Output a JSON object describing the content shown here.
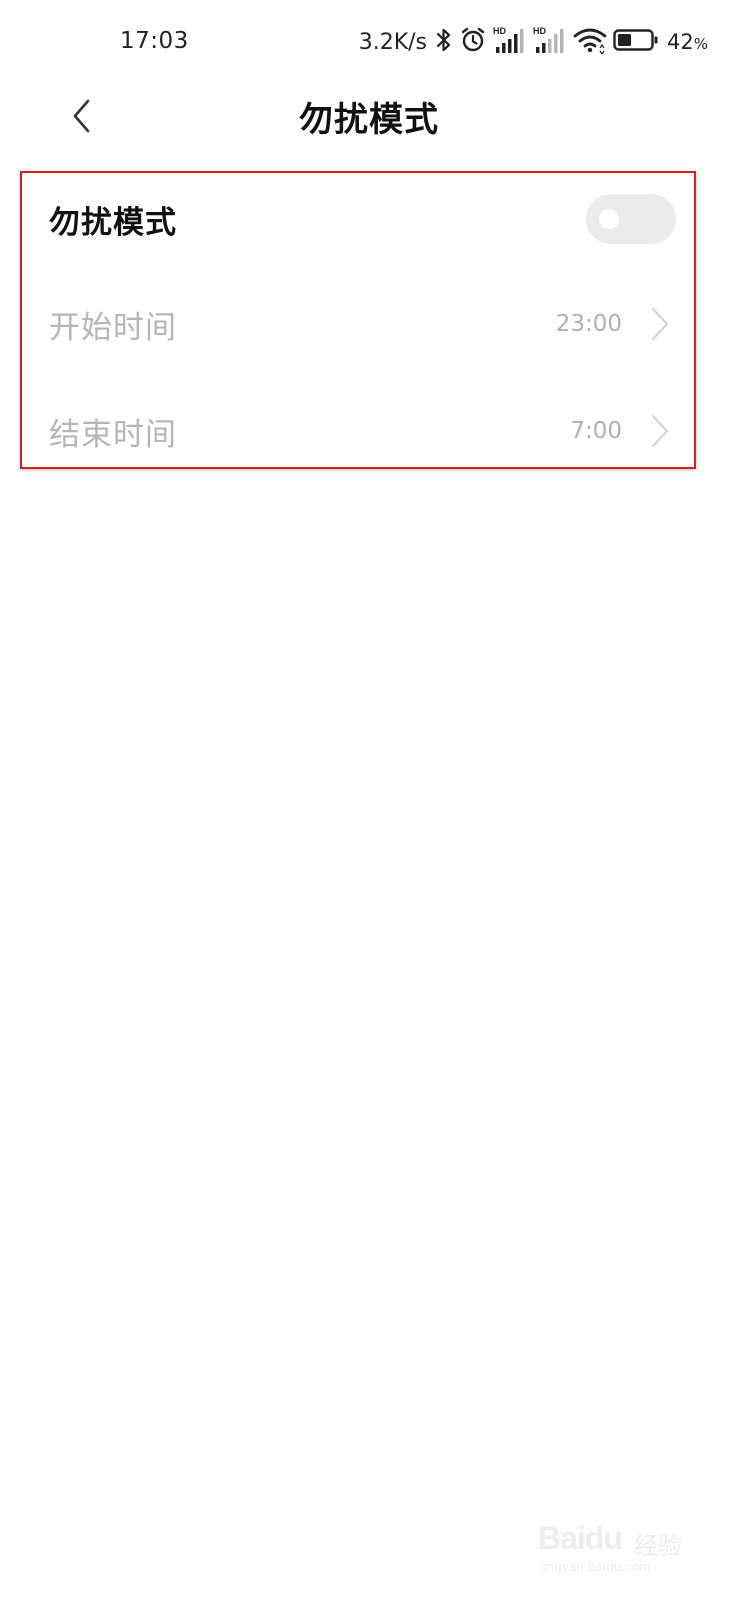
{
  "status_bar": {
    "time": "17:03",
    "net_speed": "3.2K/s",
    "network_badge_1": "HD",
    "network_badge_2": "HD",
    "battery_level": "42",
    "battery_unit": "%",
    "battery_fraction": 0.42,
    "icons": [
      "bluetooth-icon",
      "alarm-icon",
      "signal-hd-icon",
      "signal-hd-icon",
      "wifi-icon",
      "battery-icon"
    ]
  },
  "nav": {
    "title": "勿扰模式",
    "back_icon": "chevron-left-icon"
  },
  "settings": {
    "dnd": {
      "label": "勿扰模式",
      "enabled": false
    },
    "start_time": {
      "label": "开始时间",
      "value": "23:00"
    },
    "end_time": {
      "label": "结束时间",
      "value": "7:00"
    }
  },
  "watermark": {
    "brand": "Baidu",
    "sub": "经验",
    "url": "jingyan.baidu.com"
  },
  "colors": {
    "highlight_border": "#d91f26",
    "disabled_text": "#b5b5b5",
    "toggle_off": "#ebebeb"
  }
}
